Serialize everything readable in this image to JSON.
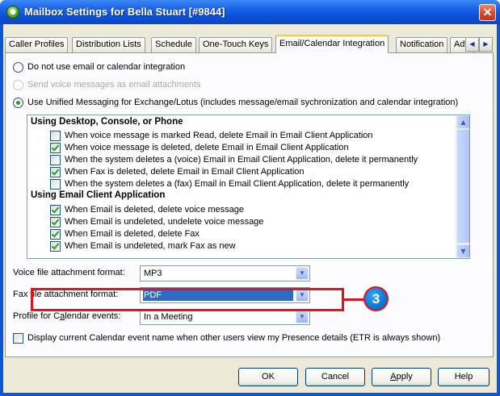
{
  "window": {
    "title": "Mailbox Settings for Bella Stuart [#9844]",
    "close_glyph": "✕",
    "icon": "app-icon"
  },
  "tabs": [
    {
      "label": "Caller Profiles"
    },
    {
      "label": "Distribution Lists"
    },
    {
      "label": "Schedule"
    },
    {
      "label": "One-Touch Keys"
    },
    {
      "label": "Email/Calendar Integration",
      "active": true
    },
    {
      "label": "Notification"
    },
    {
      "label": "Adv."
    }
  ],
  "integration": {
    "option_none": "Do not use email or calendar integration",
    "option_attach": "Send voice messages as email attachments",
    "option_um": "Use Unified Messaging for Exchange/Lotus (includes message/email sychronization and calendar integration)",
    "selected": "option_um"
  },
  "sync_list": {
    "group1_header": "Using Desktop, Console, or Phone",
    "group1_items": [
      {
        "label": "When voice message is marked Read, delete Email in Email Client Application",
        "checked": false
      },
      {
        "label": "When voice message is deleted, delete Email in Email Client Application",
        "checked": true
      },
      {
        "label": "When the system deletes a (voice) Email in Email Client Application, delete it permanently",
        "checked": false
      },
      {
        "label": "When Fax is deleted, delete Email in Email Client Application",
        "checked": true
      },
      {
        "label": "When the system deletes a (fax) Email in Email Client Application, delete it permanently",
        "checked": false
      }
    ],
    "group2_header": "Using Email Client Application",
    "group2_items": [
      {
        "label": "When Email is deleted, delete voice message",
        "checked": true
      },
      {
        "label": "When Email is undeleted, undelete voice message",
        "checked": true
      },
      {
        "label": "When Email is deleted, delete Fax",
        "checked": true
      },
      {
        "label": "When Email is undeleted, mark Fax as new",
        "checked": true
      }
    ]
  },
  "fields": {
    "voice_label": "Voice file attachment format:",
    "voice_value": "MP3",
    "fax_label": "Fax file attachment format:",
    "fax_value": "PDF",
    "calendar_label_pre": "Profile for C",
    "calendar_label_u": "a",
    "calendar_label_post": "lendar events:",
    "calendar_value": "In a Meeting"
  },
  "presence_checkbox": {
    "label": "Display current Calendar event name when other users view my Presence details (ETR is always shown)",
    "checked": false
  },
  "callout": {
    "number": "3",
    "color": "#e0141e"
  },
  "buttons": {
    "ok": "OK",
    "cancel": "Cancel",
    "apply_u": "A",
    "apply_rest": "pply",
    "help": "Help"
  },
  "colors": {
    "title_bar": "#0a4fd6",
    "dialog_bg": "#ece9d8",
    "check_green": "#21a121",
    "selection_blue": "#316ac5"
  }
}
